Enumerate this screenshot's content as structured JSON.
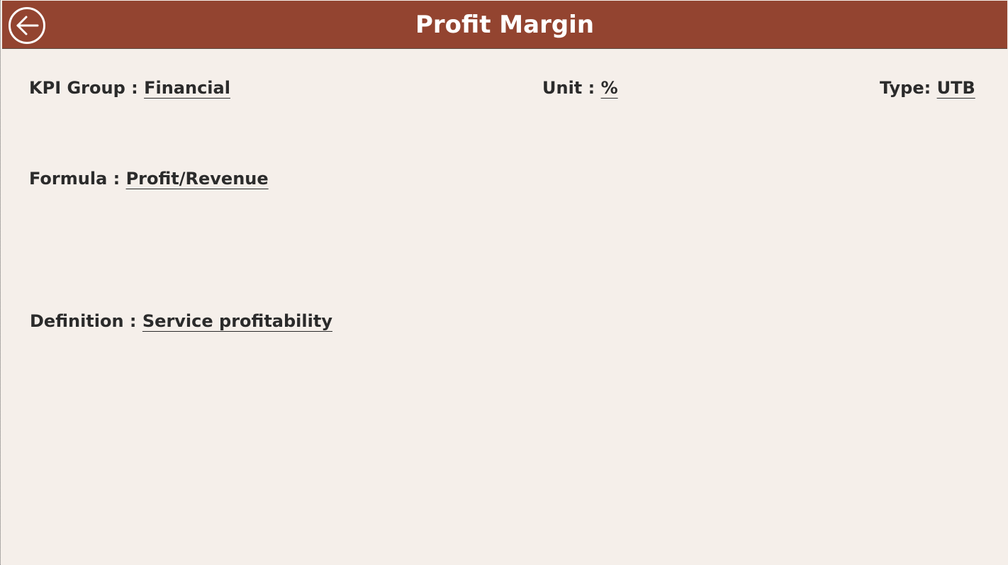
{
  "header": {
    "title": "Profit Margin",
    "back_icon": "back-arrow-icon",
    "background_color": "#934430"
  },
  "kpi": {
    "group_label": "KPI Group : ",
    "group_value": "Financial",
    "unit_label": "Unit : ",
    "unit_value": "%",
    "type_label": "Type: ",
    "type_value": "UTB",
    "formula_label": "Formula : ",
    "formula_value": "Profit/Revenue",
    "definition_label": "Definition : ",
    "definition_value": "Service profitability"
  },
  "colors": {
    "page_background": "#f5efea",
    "text": "#2b2b2b"
  }
}
